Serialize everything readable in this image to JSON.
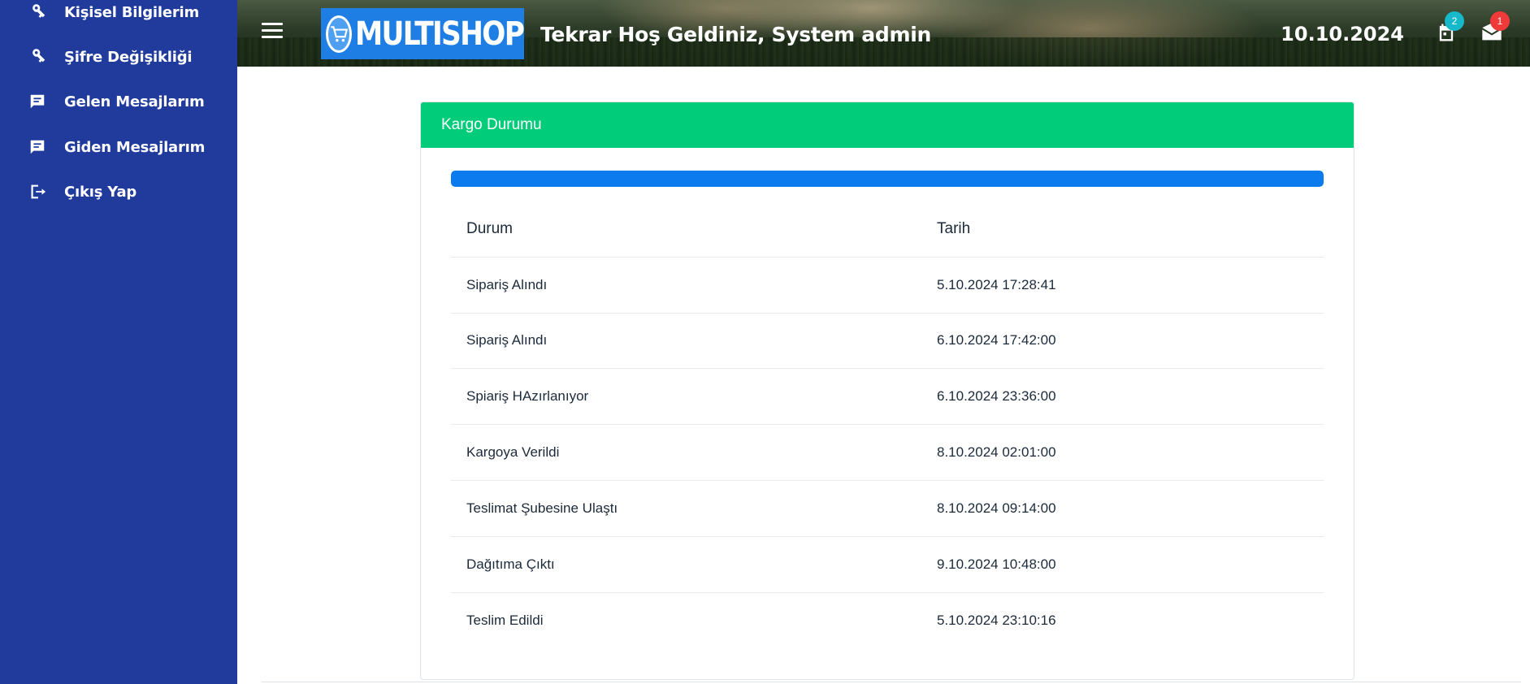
{
  "sidebar": {
    "items": [
      {
        "label": "Kişisel Bilgilerim",
        "icon": "key-icon"
      },
      {
        "label": "Şifre Değişikliği",
        "icon": "key-icon"
      },
      {
        "label": "Gelen Mesajlarım",
        "icon": "message-icon"
      },
      {
        "label": "Giden Mesajlarım",
        "icon": "message-icon"
      },
      {
        "label": "Çıkış Yap",
        "icon": "logout-icon"
      }
    ]
  },
  "header": {
    "menu_icon": "hamburger-menu-icon",
    "logo_text": "MULTISHOP",
    "welcome": "Tekrar Hoş Geldiniz, System admin",
    "date": "10.10.2024",
    "notifications": {
      "icon": "calendar-notification-icon",
      "count": "2",
      "color": "#17b8c9"
    },
    "messages": {
      "icon": "envelope-icon",
      "count": "1",
      "color": "#f03a3a"
    }
  },
  "card": {
    "title": "Kargo Durumu",
    "header_color": "#00cc7a",
    "progress": {
      "percent": 100,
      "color": "#0b7bee"
    },
    "table": {
      "headers": [
        "Durum",
        "Tarih"
      ],
      "rows": [
        {
          "status": "Sipariş Alındı",
          "date": "5.10.2024 17:28:41"
        },
        {
          "status": "Sipariş Alındı",
          "date": "6.10.2024 17:42:00"
        },
        {
          "status": "Spiariş HAzırlanıyor",
          "date": "6.10.2024 23:36:00"
        },
        {
          "status": "Kargoya Verildi",
          "date": "8.10.2024 02:01:00"
        },
        {
          "status": "Teslimat Şubesine Ulaştı",
          "date": "8.10.2024 09:14:00"
        },
        {
          "status": "Dağıtıma Çıktı",
          "date": "9.10.2024 10:48:00"
        },
        {
          "status": "Teslim Edildi",
          "date": "5.10.2024 23:10:16"
        }
      ]
    }
  }
}
